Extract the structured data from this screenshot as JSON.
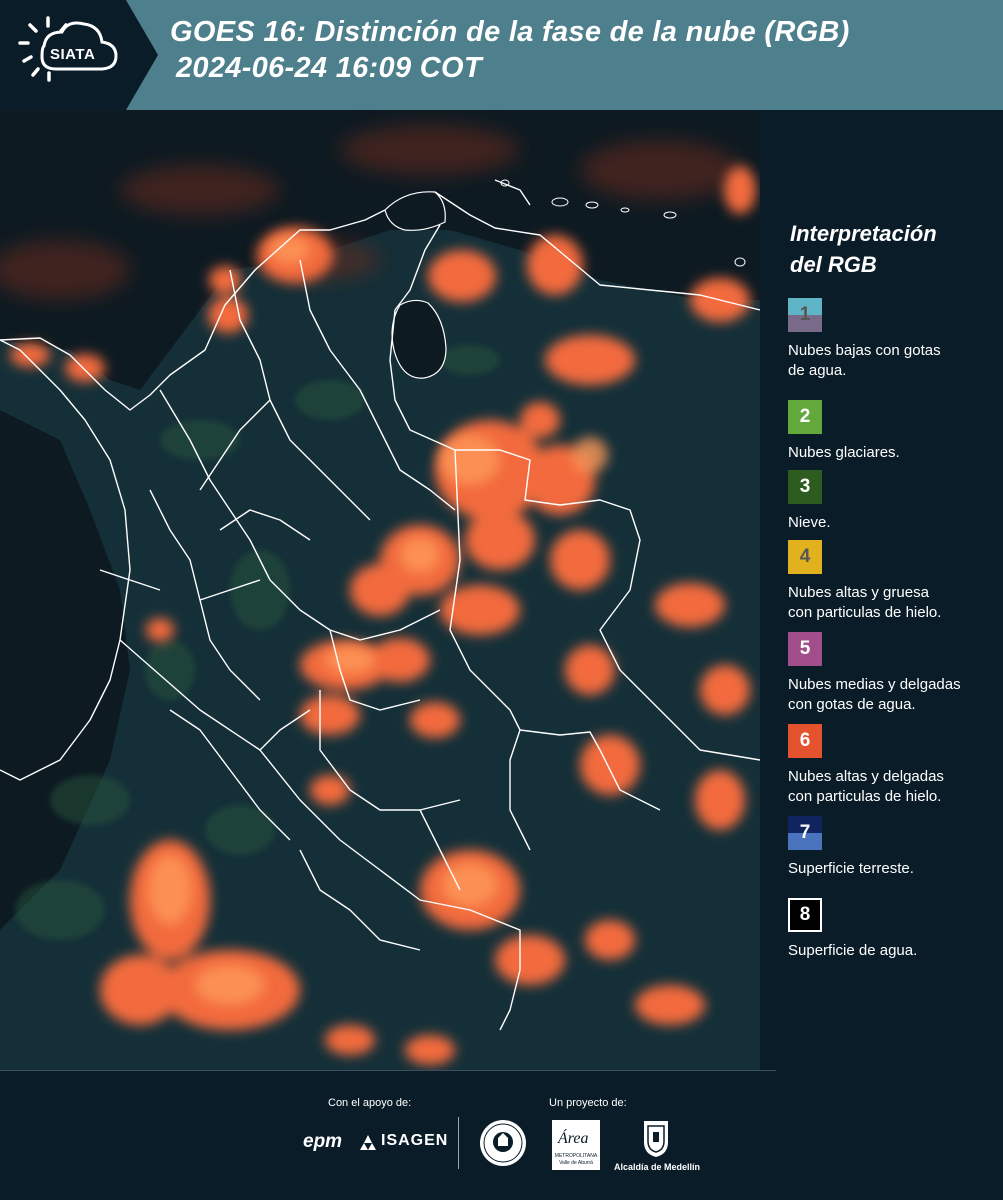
{
  "header": {
    "logo_text": "SIATA",
    "title_line1": "GOES 16: Distinción de la fase de la nube (RGB)",
    "title_line2": "2024-06-24 16:09 COT",
    "background": "#4e7f8c",
    "logo_background": "#0a1c28"
  },
  "legend": {
    "title_line1": "Interpretación",
    "title_line2": "del RGB",
    "items": [
      {
        "number": "1",
        "label_line1": "Nubes bajas con gotas",
        "label_line2": "de agua.",
        "color_top": "#5fb5c6",
        "color_bottom": "#7a6a8a",
        "number_color": "#555555"
      },
      {
        "number": "2",
        "label_line1": "Nubes glaciares.",
        "label_line2": "",
        "color_top": "#62a83a",
        "color_bottom": "#62a83a",
        "number_color": "#ffffff"
      },
      {
        "number": "3",
        "label_line1": "Nieve.",
        "label_line2": "",
        "color_top": "#2e5b1e",
        "color_bottom": "#2e5b1e",
        "number_color": "#ffffff"
      },
      {
        "number": "4",
        "label_line1": "Nubes altas y gruesa",
        "label_line2": "con particulas de hielo.",
        "color_top": "#e2b21e",
        "color_bottom": "#e2b21e",
        "number_color": "#555555"
      },
      {
        "number": "5",
        "label_line1": "Nubes medias y delgadas",
        "label_line2": "con gotas de agua.",
        "color_top": "#a24e8a",
        "color_bottom": "#a24e8a",
        "number_color": "#ffffff"
      },
      {
        "number": "6",
        "label_line1": "Nubes altas y delgadas",
        "label_line2": "con particulas de hielo.",
        "color_top": "#e5522e",
        "color_bottom": "#e5522e",
        "number_color": "#ffffff"
      },
      {
        "number": "7",
        "label_line1": "Superficie terreste.",
        "label_line2": "",
        "color_top": "#10255f",
        "color_bottom": "#4a73bd",
        "number_color": "#ffffff"
      },
      {
        "number": "8",
        "label_line1": "Superficie de agua.",
        "label_line2": "",
        "color_top": "#000000",
        "color_bottom": "#000000",
        "number_color": "#ffffff"
      }
    ]
  },
  "map": {
    "background": "#0d1a22",
    "cloud_color": "#f26a3c",
    "cloud_highlight": "#ff9a5a",
    "land_color": "#13303a",
    "boundary_color": "#ffffff"
  },
  "footer": {
    "support_label": "Con el apoyo de:",
    "project_label": "Un proyecto de:",
    "sponsor1": "epm",
    "sponsor2": "ISAGEN",
    "partner3_line1": "Área",
    "partner3_line2": "METROPOLITANA",
    "partner3_line3": "Valle de Aburrá",
    "partner4": "Alcaldía de Medellín"
  }
}
